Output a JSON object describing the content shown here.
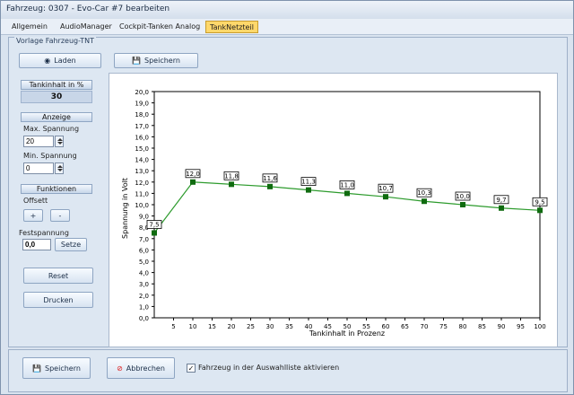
{
  "window": {
    "title": "Fahrzeug: 0307 - Evo-Car #7 bearbeiten"
  },
  "tabs": [
    {
      "label": "Allgemein"
    },
    {
      "label": "AudioManager"
    },
    {
      "label": "Cockpit-Tanken Analog"
    },
    {
      "label": "TankNetzteil"
    }
  ],
  "group": {
    "title": "Vorlage Fahrzeug-TNT"
  },
  "toolbar": {
    "load_label": "Laden",
    "save_label": "Speichern"
  },
  "left": {
    "tank_label": "Tankinhalt in %",
    "tank_value": "30",
    "anzeige_label": "Anzeige",
    "max_label": "Max. Spannung",
    "max_value": "20",
    "min_label": "Min. Spannung",
    "min_value": "0",
    "funktionen_label": "Funktionen",
    "offsett_label": "Offsett",
    "plus_label": "+",
    "minus_label": "-",
    "fest_label": "Festspannung",
    "fest_value": "0,0",
    "setze_label": "Setze",
    "reset_label": "Reset",
    "drucken_label": "Drucken"
  },
  "bottom": {
    "save_label": "Speichern",
    "cancel_label": "Abbrechen",
    "checkbox_label": "Fahrzeug in der Auswahlliste aktivieren",
    "checkbox_checked": true
  },
  "chart_data": {
    "type": "line",
    "xlabel": "Tankinhalt in Prozenz",
    "ylabel": "Spannung in Volt",
    "xlim": [
      0,
      100
    ],
    "ylim": [
      0,
      20
    ],
    "x": [
      0,
      10,
      20,
      30,
      40,
      50,
      60,
      70,
      80,
      90,
      100
    ],
    "y": [
      7.5,
      12.0,
      11.8,
      11.6,
      11.3,
      11.0,
      10.7,
      10.3,
      10.0,
      9.7,
      9.5
    ],
    "labels": [
      "7,5",
      "12,0",
      "11,8",
      "11,6",
      "11,3",
      "11,0",
      "10,7",
      "10,3",
      "10,0",
      "9,7",
      "9,5"
    ],
    "xticks": [
      5,
      10,
      15,
      20,
      25,
      30,
      35,
      40,
      45,
      50,
      55,
      60,
      65,
      70,
      75,
      80,
      85,
      90,
      95,
      100
    ],
    "yticks": [
      "0,0",
      "1,0",
      "2,0",
      "3,0",
      "4,0",
      "5,0",
      "6,0",
      "7,0",
      "8,0",
      "9,0",
      "10,0",
      "11,0",
      "12,0",
      "13,0",
      "14,0",
      "15,0",
      "16,0",
      "17,0",
      "18,0",
      "19,0",
      "20,0"
    ],
    "line_color": "#2d9b2d",
    "marker_color": "#0f6b0f"
  }
}
